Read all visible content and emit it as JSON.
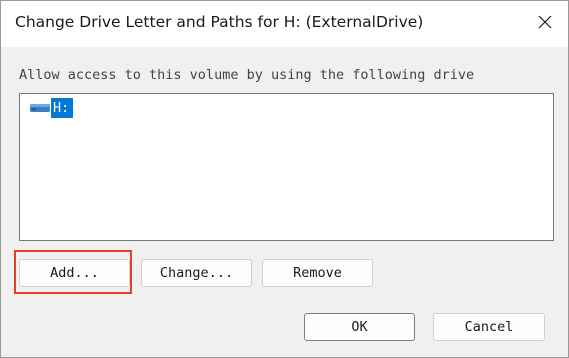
{
  "window": {
    "title": "Change Drive Letter and Paths for H: (ExternalDrive)"
  },
  "titlebar": {
    "close_icon": "close-icon"
  },
  "main": {
    "prompt": "Allow access to this volume by using the following drive",
    "list": {
      "items": [
        {
          "icon": "drive-icon",
          "label": "H:",
          "selected": true
        }
      ]
    },
    "buttons": {
      "add": "Add...",
      "change": "Change...",
      "remove": "Remove"
    }
  },
  "footer": {
    "ok": "OK",
    "cancel": "Cancel"
  },
  "colors": {
    "selection": "#0078d7",
    "highlight_box": "#e33d2d"
  }
}
